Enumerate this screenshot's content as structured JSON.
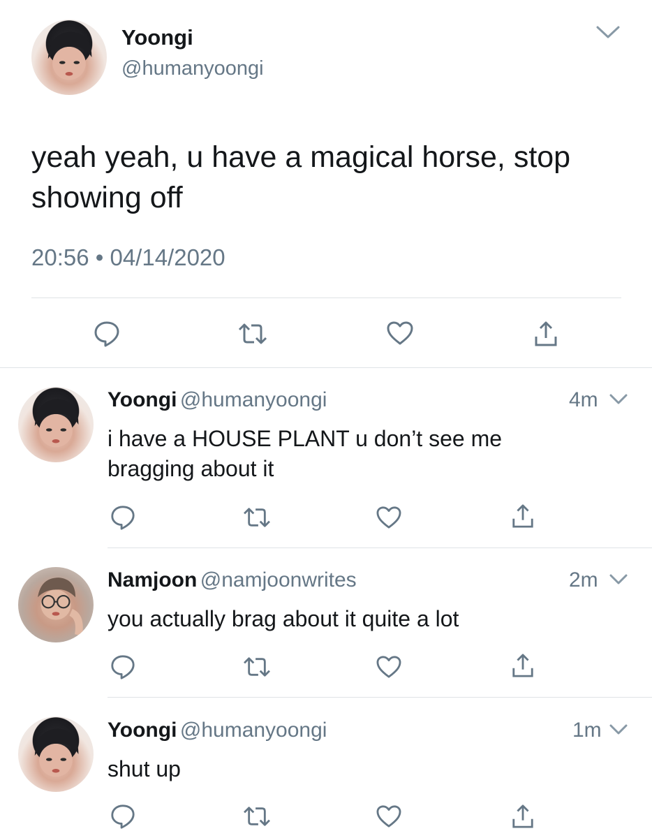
{
  "main_tweet": {
    "name": "Yoongi",
    "handle": "@humanyoongi",
    "text": "yeah yeah, u have a magical horse, stop showing off",
    "timestamp": "20:56 • 04/14/2020"
  },
  "replies": [
    {
      "name": "Yoongi",
      "handle": "@humanyoongi",
      "time": "4m",
      "text": "i have a HOUSE PLANT u don’t see me bragging about it"
    },
    {
      "name": "Namjoon",
      "handle": "@namjoonwrites",
      "time": "2m",
      "text": "you actually brag about it quite a lot"
    },
    {
      "name": "Yoongi",
      "handle": "@humanyoongi",
      "time": "1m",
      "text": "shut up"
    }
  ],
  "icons": [
    "reply-icon",
    "retweet-icon",
    "like-icon",
    "share-icon",
    "chevron-down-icon"
  ],
  "colors": {
    "text": "#14171a",
    "secondary": "#657786",
    "divider": "#dfe3e6"
  }
}
